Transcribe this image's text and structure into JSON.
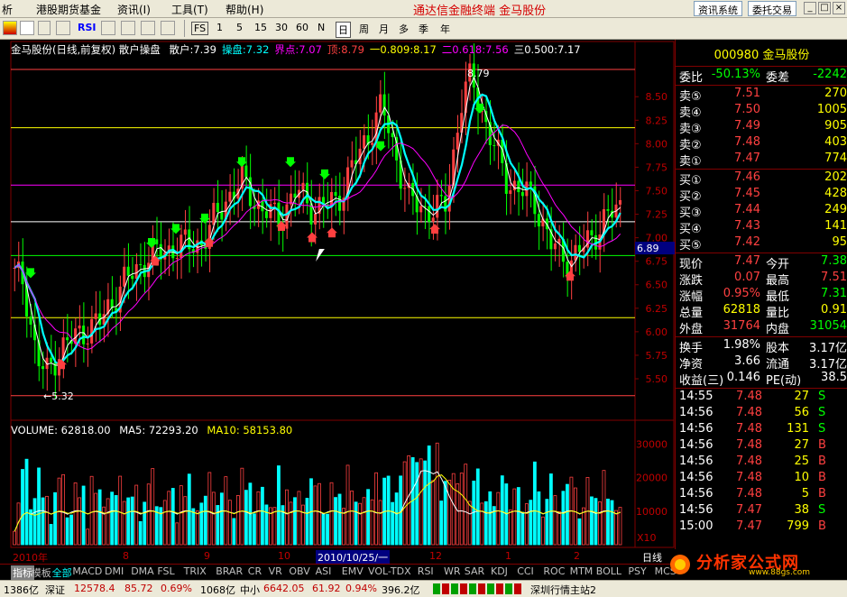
{
  "menu": {
    "items": [
      "析",
      "港股期货基金",
      "资讯(I)",
      "工具(T)",
      "帮助(H)"
    ],
    "title": "通达信金融终端  金马股份",
    "right_buttons": [
      "资讯系统",
      "委托交易"
    ]
  },
  "toolbar": {
    "periods": [
      "1",
      "5",
      "15",
      "30",
      "60",
      "N",
      "日",
      "周",
      "月",
      "多",
      "季",
      "年"
    ],
    "fs_label": "FS",
    "rsi_label": "RSI"
  },
  "chart": {
    "title": "金马股份(日线,前复权) 散户操盘",
    "indicators": [
      {
        "label": "散户:",
        "value": "7.39",
        "color": "#ffffff"
      },
      {
        "label": "操盘:",
        "value": "7.32",
        "color": "#00ffff"
      },
      {
        "label": "界点:",
        "value": "7.07",
        "color": "#ff00ff"
      },
      {
        "label": "顶:",
        "value": "8.79",
        "color": "#ff4040"
      },
      {
        "label": "一0.809:",
        "value": "8.17",
        "color": "#ffff00"
      },
      {
        "label": "二0.618:",
        "value": "7.56",
        "color": "#ff00ff"
      },
      {
        "label": "三0.500:",
        "value": "7.17",
        "color": "#ffffff"
      }
    ],
    "price_axis": [
      "8.50",
      "8.25",
      "8.00",
      "7.75",
      "7.50",
      "7.25",
      "7.00",
      "6.75",
      "6.50",
      "6.25",
      "6.00",
      "5.75",
      "5.50"
    ],
    "current_price_tag": "6.89",
    "high_label": "8.79",
    "low_label": "5.32",
    "volume_header": {
      "volume": "VOLUME: 62818.00",
      "ma5": "MA5: 72293.20",
      "ma10": "MA10: 58153.80"
    },
    "volume_axis": [
      "30000",
      "20000",
      "10000"
    ],
    "volume_unit": "X10",
    "dates": [
      "2010年",
      "8",
      "9",
      "10",
      "2010/10/25/一",
      "12",
      "1",
      "2"
    ],
    "period_label": "日线"
  },
  "quote": {
    "code": "000980",
    "name": "金马股份",
    "weibi_label": "委比",
    "weibi": "-50.13%",
    "weicha_label": "委差",
    "weicha": "-2242",
    "asks": [
      {
        "label": "卖⑤",
        "price": "7.51",
        "vol": "270"
      },
      {
        "label": "卖④",
        "price": "7.50",
        "vol": "1005"
      },
      {
        "label": "卖③",
        "price": "7.49",
        "vol": "905"
      },
      {
        "label": "卖②",
        "price": "7.48",
        "vol": "403"
      },
      {
        "label": "卖①",
        "price": "7.47",
        "vol": "774"
      }
    ],
    "bids": [
      {
        "label": "买①",
        "price": "7.46",
        "vol": "202"
      },
      {
        "label": "买②",
        "price": "7.45",
        "vol": "428"
      },
      {
        "label": "买③",
        "price": "7.44",
        "vol": "249"
      },
      {
        "label": "买④",
        "price": "7.43",
        "vol": "141"
      },
      {
        "label": "买⑤",
        "price": "7.42",
        "vol": "95"
      }
    ],
    "stats": [
      {
        "l1": "现价",
        "v1": "7.47",
        "l2": "今开",
        "v2": "7.38",
        "c1": "#ff4040",
        "c2": "#00ff00"
      },
      {
        "l1": "涨跌",
        "v1": "0.07",
        "l2": "最高",
        "v2": "7.51",
        "c1": "#ff4040",
        "c2": "#ff4040"
      },
      {
        "l1": "涨幅",
        "v1": "0.95%",
        "l2": "最低",
        "v2": "7.31",
        "c1": "#ff4040",
        "c2": "#00ff00"
      },
      {
        "l1": "总量",
        "v1": "62818",
        "l2": "量比",
        "v2": "0.91",
        "c1": "#ffff00",
        "c2": "#ffff00"
      },
      {
        "l1": "外盘",
        "v1": "31764",
        "l2": "内盘",
        "v2": "31054",
        "c1": "#ff4040",
        "c2": "#00ff00"
      }
    ],
    "stats2": [
      {
        "l1": "换手",
        "v1": "1.98%",
        "l2": "股本",
        "v2": "3.17亿"
      },
      {
        "l1": "净资",
        "v1": "3.66",
        "l2": "流通",
        "v2": "3.17亿"
      },
      {
        "l1": "收益(三)",
        "v1": "0.146",
        "l2": "PE(动)",
        "v2": "38.5"
      }
    ],
    "ticks": [
      {
        "time": "14:55",
        "price": "7.48",
        "vol": "27",
        "side": "S"
      },
      {
        "time": "14:56",
        "price": "7.48",
        "vol": "56",
        "side": "S"
      },
      {
        "time": "14:56",
        "price": "7.48",
        "vol": "131",
        "side": "S"
      },
      {
        "time": "14:56",
        "price": "7.48",
        "vol": "27",
        "side": "B"
      },
      {
        "time": "14:56",
        "price": "7.48",
        "vol": "25",
        "side": "B"
      },
      {
        "time": "14:56",
        "price": "7.48",
        "vol": "10",
        "side": "B"
      },
      {
        "time": "14:56",
        "price": "7.48",
        "vol": "5",
        "side": "B"
      },
      {
        "time": "14:56",
        "price": "7.47",
        "vol": "38",
        "side": "S"
      },
      {
        "time": "15:00",
        "price": "7.47",
        "vol": "799",
        "side": "B"
      }
    ]
  },
  "indicator_tabs": [
    "指标",
    "模板",
    "全部",
    "MACD",
    "DMI",
    "DMA",
    "FSL",
    "TRIX",
    "BRAR",
    "CR",
    "VR",
    "OBV",
    "ASI",
    "EMV",
    "VOL-TDX",
    "RSI",
    "WR",
    "SAR",
    "KDJ",
    "CCI",
    "ROC",
    "MTM",
    "BOLL",
    "PSY",
    "MCST"
  ],
  "statusbar": {
    "items": [
      "1386亿",
      "深证",
      "12578.4",
      "85.72",
      "0.69%",
      "1068亿",
      "中小",
      "6642.05",
      "61.92",
      "0.94%",
      "396.2亿",
      "深圳行情主站2"
    ]
  },
  "watermark": {
    "text": "分析家公式网",
    "url": "www.88gs.com"
  },
  "colors": {
    "up": "#ff4040",
    "down": "#00ff00",
    "cyan": "#00ffff",
    "magenta": "#ff00ff",
    "yellow": "#ffff00"
  }
}
